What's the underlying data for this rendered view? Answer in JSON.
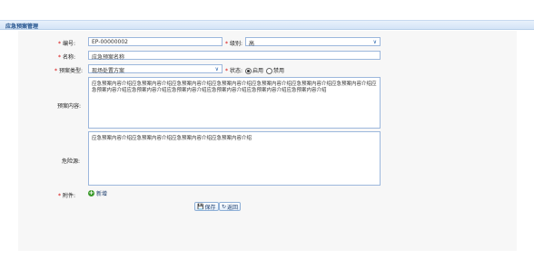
{
  "header": {
    "title": "应急预案管理"
  },
  "form": {
    "code": {
      "label": "编号:",
      "value": "EP-00000002"
    },
    "level": {
      "label": "级别:",
      "value": "高"
    },
    "name": {
      "label": "名称:",
      "value": "应急预案名称"
    },
    "type": {
      "label": "预案类型:",
      "value": "现场处置方案"
    },
    "status": {
      "label": "状态:",
      "options": [
        "启用",
        "禁用"
      ],
      "selected": "启用"
    },
    "content": {
      "label": "预案内容:",
      "value": "应急预案内容介绍应急预案内容介绍应急预案内容介绍应急预案内容介绍应急预案内容介绍应急预案内容介绍应急预案内容介绍应急预案内容介绍应急预案内容介绍应急预案内容介绍应急预案内容介绍应急预案内容介绍应急预案内容介绍"
    },
    "hazard": {
      "label": "危险源:",
      "value": "应急预案内容介绍应急预案内容介绍应急预案内容介绍应急预案内容介绍"
    },
    "attachment": {
      "label": "附件:",
      "add_label": "新增"
    }
  },
  "buttons": {
    "save": "保存",
    "back": "返回"
  },
  "colors": {
    "border": "#9cb7dc",
    "header": "#d4e4f7",
    "required": "#d40000"
  },
  "icons": {
    "chevron": "chevron-down-icon",
    "add": "plus-circle-icon",
    "save": "floppy-icon",
    "back": "refresh-icon"
  }
}
